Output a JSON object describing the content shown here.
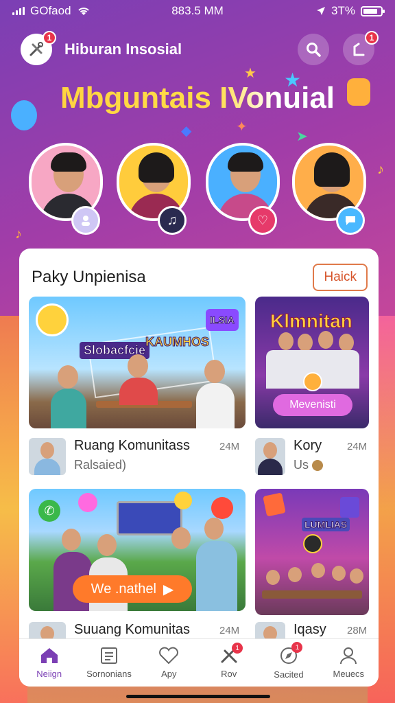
{
  "status_bar": {
    "carrier": "GOfaod",
    "time": "883.5 MM",
    "battery_pct": "3T%"
  },
  "header": {
    "logo_badge": "1",
    "title": "Hiburan Insosial",
    "notif_badge": "1"
  },
  "hero": {
    "title": "Mbguntais IVonuial"
  },
  "card": {
    "title": "Paky Unpienisa",
    "button": "Haick",
    "tiles": [
      {
        "label": "Slobacfcie",
        "label2": "KAUMHOS",
        "label3": "ILSIA"
      },
      {
        "label": "Klmnitan",
        "button": "Mevenisti"
      },
      {
        "button": "We .nathel"
      },
      {
        "label": "LUMLIAS"
      }
    ],
    "items": [
      {
        "title": "Ruang Komunitass",
        "subtitle": "Ralsaied)",
        "count": "24M"
      },
      {
        "title": "Kory",
        "subtitle": "Us",
        "count": "24M"
      },
      {
        "title": "Suuang Komunitas",
        "count": "24M"
      },
      {
        "title": "Iqasy",
        "count": "28M"
      }
    ]
  },
  "nav": [
    {
      "label": "Neiign",
      "icon": "home-icon"
    },
    {
      "label": "Sornonians",
      "icon": "document-icon"
    },
    {
      "label": "Apy",
      "icon": "heart-icon"
    },
    {
      "label": "Rov",
      "icon": "tools-icon",
      "badge": "1"
    },
    {
      "label": "Sacited",
      "icon": "compass-icon",
      "badge": "1"
    },
    {
      "label": "Meuecs",
      "icon": "user-icon"
    }
  ]
}
